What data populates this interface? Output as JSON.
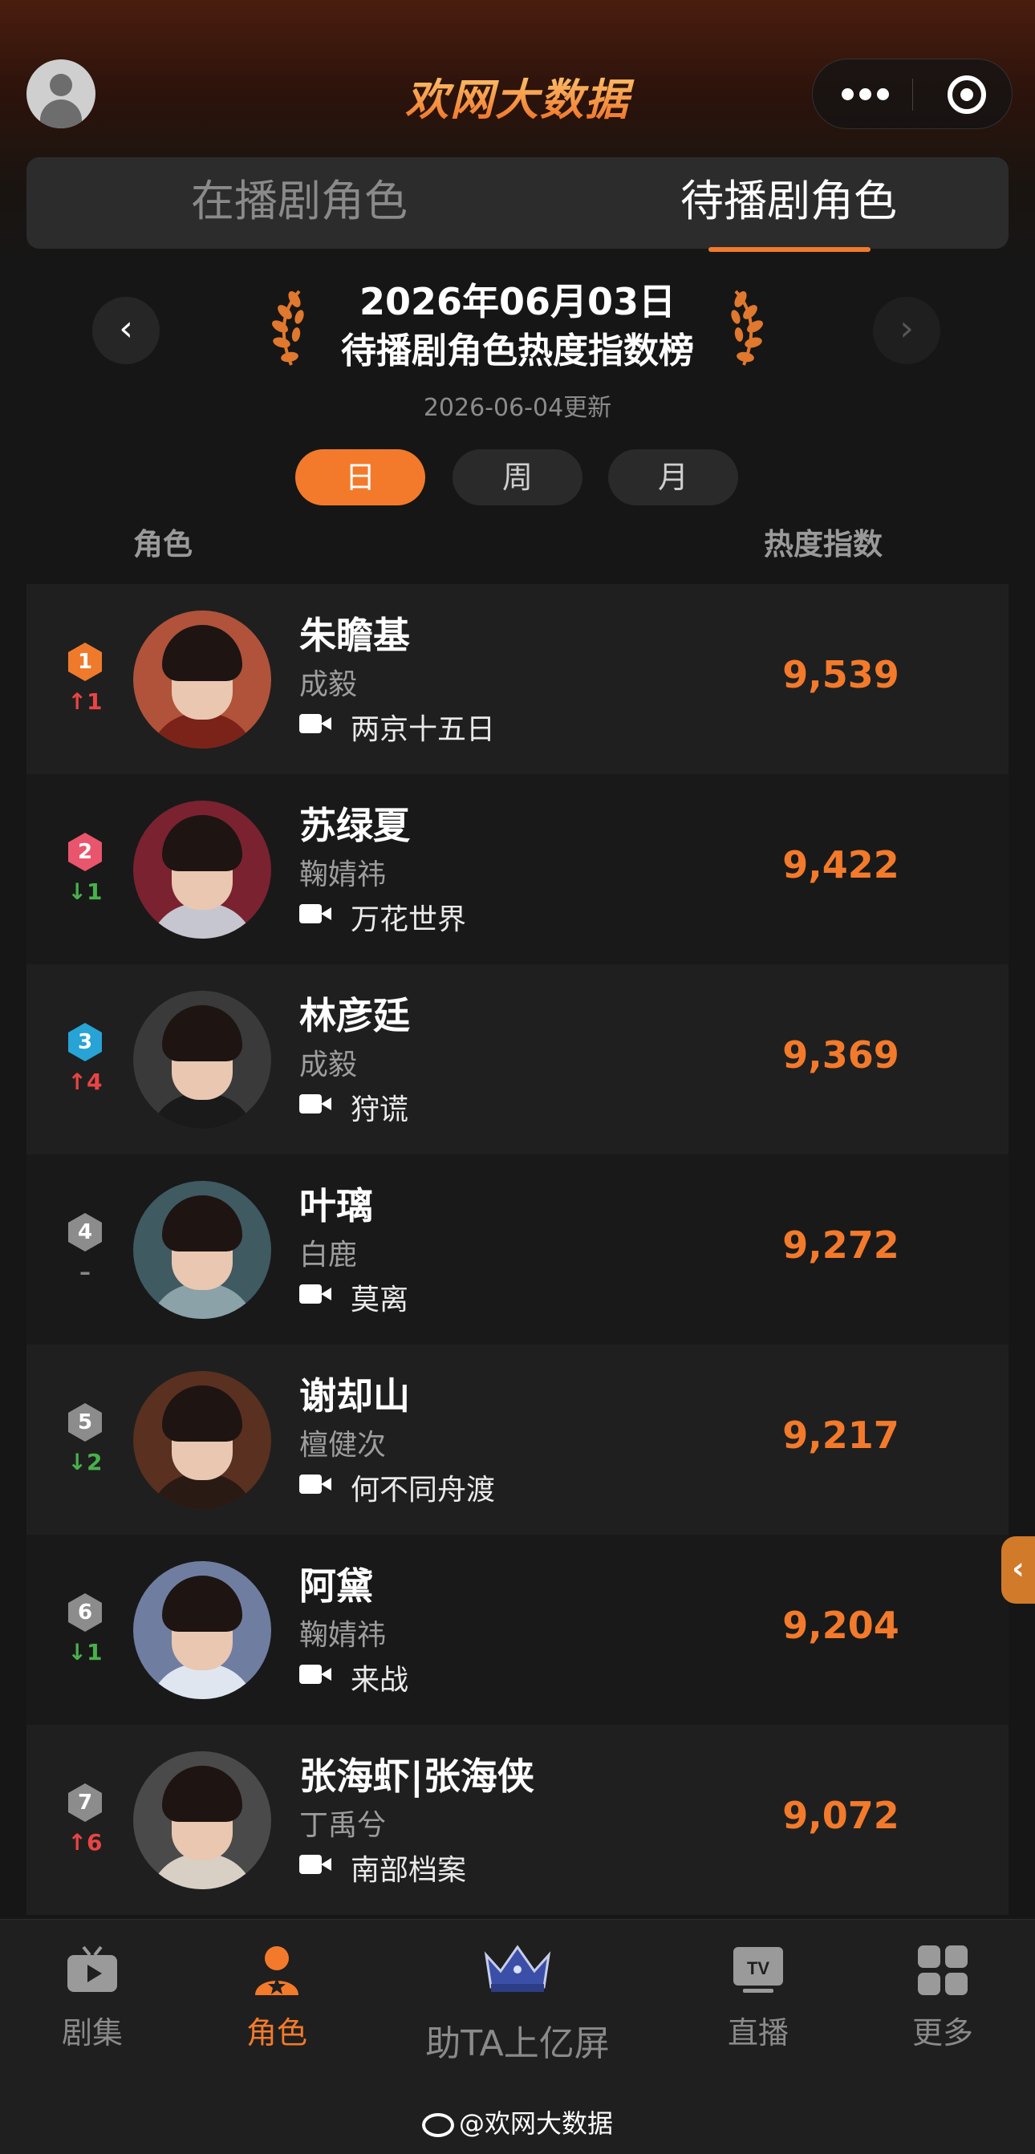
{
  "header": {
    "logo_text": "欢网大数据",
    "accent_color": "#f37a2b"
  },
  "tabs": [
    {
      "label": "在播剧角色",
      "active": false
    },
    {
      "label": "待播剧角色",
      "active": true
    }
  ],
  "date_title": "2026年06月03日",
  "board_title": "待播剧角色热度指数榜",
  "updated": "2026-06-04更新",
  "periods": [
    {
      "label": "日",
      "active": true
    },
    {
      "label": "周",
      "active": false
    },
    {
      "label": "月",
      "active": false
    }
  ],
  "columns": {
    "left": "角色",
    "right": "热度指数"
  },
  "rankings": [
    {
      "rank": "1",
      "change": "↑1",
      "trend": "up",
      "name": "朱瞻基",
      "actor": "成毅",
      "drama": "两京十五日",
      "score": "9,539"
    },
    {
      "rank": "2",
      "change": "↓1",
      "trend": "down",
      "name": "苏绿夏",
      "actor": "鞠婧祎",
      "drama": "万花世界",
      "score": "9,422"
    },
    {
      "rank": "3",
      "change": "↑4",
      "trend": "up",
      "name": "林彦廷",
      "actor": "成毅",
      "drama": "狩谎",
      "score": "9,369"
    },
    {
      "rank": "4",
      "change": "–",
      "trend": "flat",
      "name": "叶璃",
      "actor": "白鹿",
      "drama": "莫离",
      "score": "9,272"
    },
    {
      "rank": "5",
      "change": "↓2",
      "trend": "down",
      "name": "谢却山",
      "actor": "檀健次",
      "drama": "何不同舟渡",
      "score": "9,217"
    },
    {
      "rank": "6",
      "change": "↓1",
      "trend": "down",
      "name": "阿黛",
      "actor": "鞠婧祎",
      "drama": "来战",
      "score": "9,204"
    },
    {
      "rank": "7",
      "change": "↑6",
      "trend": "up",
      "name": "张海虾|张海侠",
      "actor": "丁禹兮",
      "drama": "南部档案",
      "score": "9,072"
    }
  ],
  "bottom_nav": [
    {
      "label": "剧集",
      "icon": "tv-icon",
      "active": false
    },
    {
      "label": "角色",
      "icon": "person-icon",
      "active": true
    },
    {
      "label": "助TA上亿屏",
      "icon": "crown-icon",
      "active": false
    },
    {
      "label": "直播",
      "icon": "live-tv-icon",
      "active": false
    },
    {
      "label": "更多",
      "icon": "grid-icon",
      "active": false
    }
  ],
  "watermark": "@欢网大数据"
}
